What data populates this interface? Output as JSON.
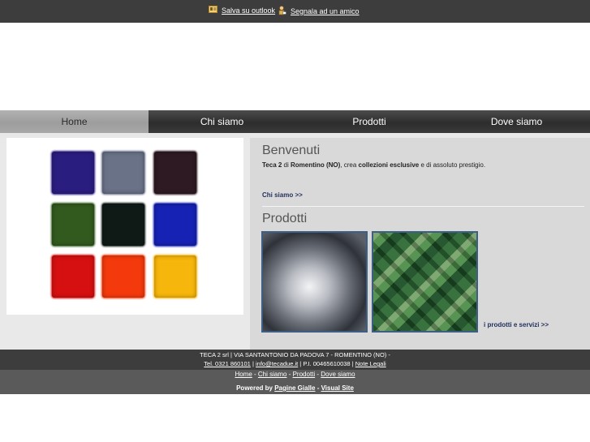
{
  "topbar": {
    "outlook_label": "Salva su outlook",
    "friend_label": "Segnala ad un amico"
  },
  "nav": {
    "items": [
      {
        "label": "Home",
        "active": true
      },
      {
        "label": "Chi siamo",
        "active": false
      },
      {
        "label": "Prodotti",
        "active": false
      },
      {
        "label": "Dove siamo",
        "active": false
      }
    ]
  },
  "swatches": [
    {
      "color": "#2a1d80"
    },
    {
      "color": "#6a7288"
    },
    {
      "color": "#2e1a22"
    },
    {
      "color": "#325a1e"
    },
    {
      "color": "#0f1a16"
    },
    {
      "color": "#1622b4"
    },
    {
      "color": "#d61010"
    },
    {
      "color": "#f43a0c"
    },
    {
      "color": "#f7b60c"
    }
  ],
  "welcome": {
    "title": "Benvenuti",
    "text_bold1": "Teca 2",
    "text_plain1": " di ",
    "text_bold2": "Romentino (NO)",
    "text_plain2": ", crea ",
    "text_bold3": "collezioni esclusive",
    "text_plain3": " e di assoluto prestigio.",
    "more_link": "Chi siamo >>"
  },
  "products": {
    "title": "Prodotti",
    "more_link": "i prodotti e servizi >>"
  },
  "footer": {
    "line1": "TECA 2 srl | VIA SANTANTONIO DA PADOVA 7 - ROMENTINO (NO) -",
    "tel": "Tel. 0321 860101",
    "email": "info@tecadue.it",
    "piva": "P.I. 00465610038",
    "legal": "Note Legali",
    "sep": " | ",
    "nav": [
      "Home",
      "Chi siamo",
      "Prodotti",
      "Dove siamo"
    ],
    "nav_sep": " - ",
    "powered_label": "Powered by ",
    "powered_link1": "Pagine Gialle",
    "powered_dash": " - ",
    "powered_link2": "Visual Site"
  },
  "colors": {
    "bar_dark": "#3d3d3d",
    "nav_active": "#a7a7a7",
    "photo_border": "#3e5f85",
    "link_blue": "#1f2f5e"
  }
}
